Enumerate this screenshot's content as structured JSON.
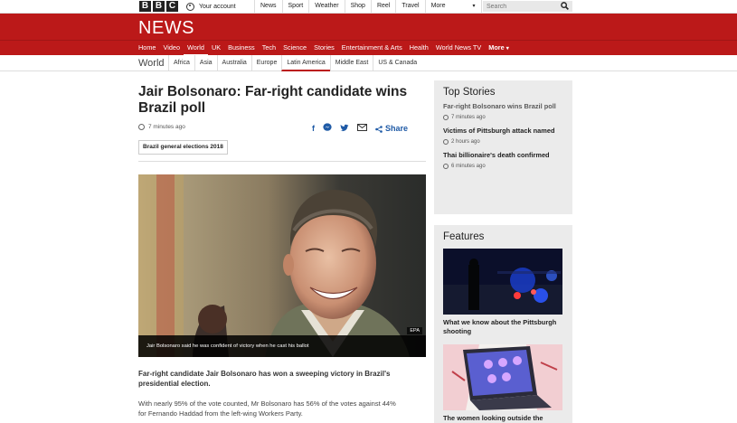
{
  "topbar": {
    "brand": [
      "B",
      "B",
      "C"
    ],
    "account_label": "Your account",
    "nav": [
      "News",
      "Sport",
      "Weather",
      "Shop",
      "Reel",
      "Travel"
    ],
    "more_label": "More",
    "search_placeholder": "Search"
  },
  "masthead": {
    "logo": "NEWS"
  },
  "news_nav": {
    "items": [
      "Home",
      "Video",
      "World",
      "UK",
      "Business",
      "Tech",
      "Science",
      "Stories",
      "Entertainment & Arts",
      "Health",
      "World News TV"
    ],
    "more_label": "More",
    "active": "World"
  },
  "section_nav": {
    "title": "World",
    "items": [
      "Africa",
      "Asia",
      "Australia",
      "Europe",
      "Latin America",
      "Middle East",
      "US & Canada"
    ],
    "active": "Latin America"
  },
  "article": {
    "headline": "Jair Bolsonaro: Far-right candidate wins Brazil poll",
    "timestamp": "7 minutes ago",
    "share_label": "Share",
    "tag": "Brazil general elections 2018",
    "image_caption": "Jair Bolsonaro said he was confident of victory when he cast his ballot",
    "image_credit": "EPA",
    "lead": "Far-right candidate Jair Bolsonaro has won a sweeping victory in Brazil's presidential election.",
    "body": "With nearly 95% of the vote counted, Mr Bolsonaro has 56% of the votes against 44% for Fernando Haddad from the left-wing Workers Party."
  },
  "top_stories": {
    "heading": "Top Stories",
    "items": [
      {
        "title": "Far-right Bolsonaro wins Brazil poll",
        "time": "7 minutes ago"
      },
      {
        "title": "Victims of Pittsburgh attack named",
        "time": "2 hours ago"
      },
      {
        "title": "Thai billionaire's death confirmed",
        "time": "6 minutes ago"
      }
    ]
  },
  "features": {
    "heading": "Features",
    "items": [
      {
        "title": "What we know about the Pittsburgh shooting"
      },
      {
        "title": "The women looking outside the"
      }
    ]
  },
  "colors": {
    "brand_red": "#bb1919",
    "link_blue": "#1f5aa6",
    "panel_bg": "#ebebeb"
  }
}
